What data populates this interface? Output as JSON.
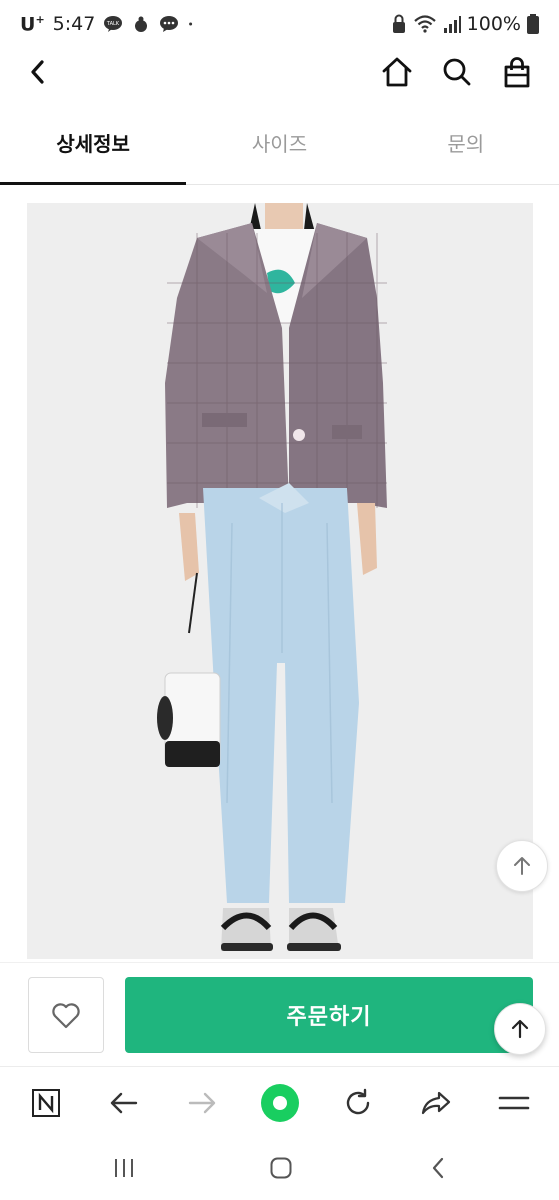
{
  "status_bar": {
    "carrier": "U",
    "carrier_sup": "+",
    "time": "5:47",
    "battery": "100%"
  },
  "header": {
    "icons": [
      "back-icon",
      "home-icon",
      "search-icon",
      "shopping-bag-icon"
    ]
  },
  "tabs": [
    {
      "label": "상세정보",
      "active": true
    },
    {
      "label": "사이즈",
      "active": false
    },
    {
      "label": "문의",
      "active": false
    }
  ],
  "buy_bar": {
    "order_label": "주문하기",
    "accent_color": "#1fb57e"
  },
  "browser_bar": {
    "icons": [
      "naver-icon",
      "back-arrow-icon",
      "forward-arrow-icon",
      "green-dot-icon",
      "refresh-icon",
      "share-icon",
      "menu-icon"
    ]
  },
  "nav_bar": {
    "icons": [
      "recent-apps-icon",
      "home-circle-icon",
      "back-chevron-icon"
    ]
  }
}
